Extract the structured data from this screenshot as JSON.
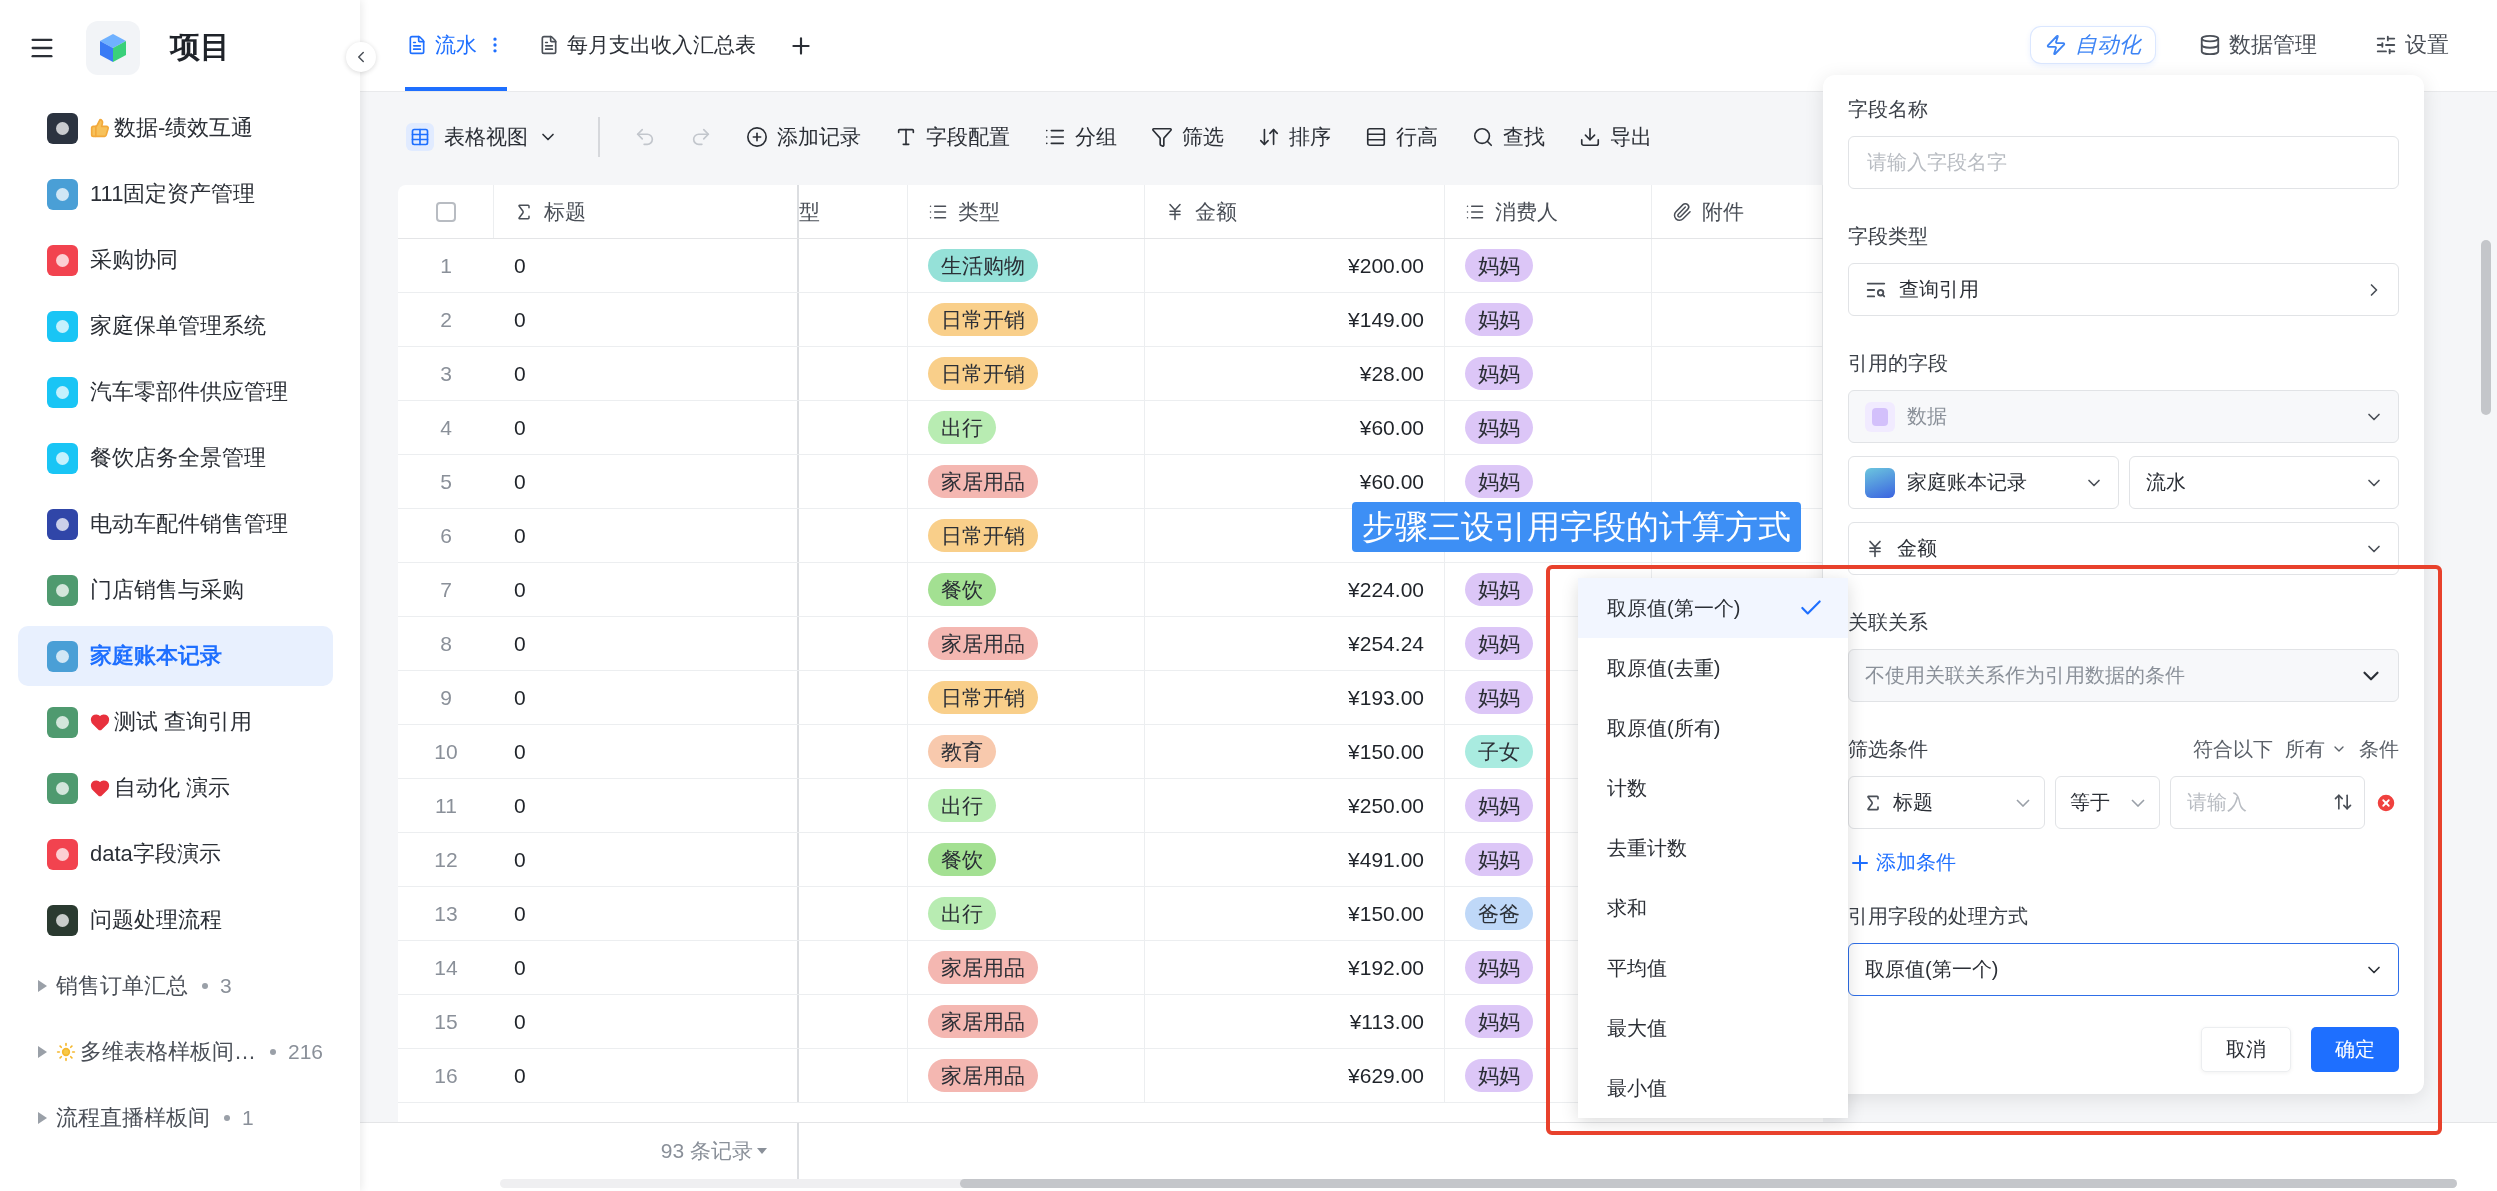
{
  "sidebar": {
    "title": "项目",
    "items": [
      {
        "label": "数据-绩效互通",
        "kind": "thumb",
        "color": "#2b3340",
        "selected": false
      },
      {
        "label": "111固定资产管理",
        "color": "#4a9fd6",
        "selected": false
      },
      {
        "label": "采购协同",
        "color": "#f2434f",
        "selected": false
      },
      {
        "label": "家庭保单管理系统",
        "color": "#19c5f5",
        "selected": false
      },
      {
        "label": "汽车零部件供应管理",
        "color": "#19c5f5",
        "selected": false
      },
      {
        "label": "餐饮店务全景管理",
        "color": "#19c5f5",
        "selected": false
      },
      {
        "label": "电动车配件销售管理",
        "color": "#3046a8",
        "selected": false
      },
      {
        "label": "门店销售与采购",
        "color": "#4f9a6f",
        "selected": false
      },
      {
        "label": "家庭账本记录",
        "color": "#4a9fd6",
        "selected": true
      },
      {
        "label": "测试 查询引用",
        "kind": "heart",
        "color": "#4f9a6f",
        "selected": false
      },
      {
        "label": "自动化 演示",
        "kind": "heart",
        "color": "#4f9a6f",
        "selected": false
      },
      {
        "label": "data字段演示",
        "color": "#f2434f",
        "selected": false
      },
      {
        "label": "问题处理流程",
        "color": "#2a3a30",
        "selected": false
      }
    ],
    "groups": [
      {
        "label": "销售订单汇总",
        "count": "3"
      },
      {
        "label": "多维表格样板间…",
        "kind": "sun",
        "count": "216"
      },
      {
        "label": "流程直播样板间",
        "count": "1"
      }
    ]
  },
  "tabs": [
    {
      "label": "流水",
      "selected": true
    },
    {
      "label": "每月支出收入汇总表",
      "selected": false
    }
  ],
  "top_actions": [
    {
      "kind": "automation",
      "label": "自动化",
      "selected": true
    },
    {
      "kind": "data",
      "label": "数据管理",
      "selected": false
    },
    {
      "kind": "settings",
      "label": "设置",
      "selected": false
    }
  ],
  "toolbar": {
    "view": "表格视图",
    "items": [
      {
        "kind": "undo",
        "disabled": true
      },
      {
        "kind": "redo",
        "disabled": true
      },
      {
        "kind": "add",
        "label": "添加记录",
        "disabled": false
      },
      {
        "kind": "fields",
        "label": "字段配置",
        "disabled": false
      },
      {
        "kind": "group",
        "label": "分组",
        "disabled": false
      },
      {
        "kind": "filter",
        "label": "筛选",
        "disabled": false
      },
      {
        "kind": "sort",
        "label": "排序",
        "disabled": false
      },
      {
        "kind": "height",
        "label": "行高",
        "disabled": false
      },
      {
        "kind": "find",
        "label": "查找",
        "disabled": false
      },
      {
        "kind": "export",
        "label": "导出",
        "disabled": false
      }
    ]
  },
  "table": {
    "select_all": {
      "checked": false
    },
    "columns": [
      {
        "kind": "sigma",
        "label": "标题"
      },
      {
        "kind": "none",
        "label": "型"
      },
      {
        "kind": "list",
        "label": "类型"
      },
      {
        "kind": "yen",
        "label": "金额"
      },
      {
        "kind": "list",
        "label": "消费人"
      },
      {
        "kind": "clip",
        "label": "附件"
      }
    ],
    "rows": [
      {
        "number": "1",
        "title": "0",
        "type": {
          "label": "生活购物",
          "color": "#95e1d8"
        },
        "amount": "¥200.00",
        "consumer": {
          "label": "妈妈",
          "color": "#dcc6f7"
        }
      },
      {
        "number": "2",
        "title": "0",
        "type": {
          "label": "日常开销",
          "color": "#f9cf8a"
        },
        "amount": "¥149.00",
        "consumer": {
          "label": "妈妈",
          "color": "#dcc6f7"
        }
      },
      {
        "number": "3",
        "title": "0",
        "type": {
          "label": "日常开销",
          "color": "#f9cf8a"
        },
        "amount": "¥28.00",
        "consumer": {
          "label": "妈妈",
          "color": "#dcc6f7"
        }
      },
      {
        "number": "4",
        "title": "0",
        "type": {
          "label": "出行",
          "color": "#b8ecb2"
        },
        "amount": "¥60.00",
        "consumer": {
          "label": "妈妈",
          "color": "#dcc6f7"
        }
      },
      {
        "number": "5",
        "title": "0",
        "type": {
          "label": "家居用品",
          "color": "#f4b7b1"
        },
        "amount": "¥60.00",
        "consumer": {
          "label": "妈妈",
          "color": "#dcc6f7"
        }
      },
      {
        "number": "6",
        "title": "0",
        "type": {
          "label": "日常开销",
          "color": "#f9cf8a"
        }
      },
      {
        "number": "7",
        "title": "0",
        "type": {
          "label": "餐饮",
          "color": "#a3e092"
        },
        "amount": "¥224.00",
        "consumer": {
          "label": "妈妈",
          "color": "#dcc6f7"
        }
      },
      {
        "number": "8",
        "title": "0",
        "type": {
          "label": "家居用品",
          "color": "#f4b7b1"
        },
        "amount": "¥254.24",
        "consumer": {
          "label": "妈妈",
          "color": "#dcc6f7"
        }
      },
      {
        "number": "9",
        "title": "0",
        "type": {
          "label": "日常开销",
          "color": "#f9cf8a"
        },
        "amount": "¥193.00",
        "consumer": {
          "label": "妈妈",
          "color": "#dcc6f7"
        }
      },
      {
        "number": "10",
        "title": "0",
        "type": {
          "label": "教育",
          "color": "#f8c9ad"
        },
        "amount": "¥150.00",
        "consumer": {
          "label": "子女",
          "color": "#a9ebe0"
        }
      },
      {
        "number": "11",
        "title": "0",
        "type": {
          "label": "出行",
          "color": "#b8ecb2"
        },
        "amount": "¥250.00",
        "consumer": {
          "label": "妈妈",
          "color": "#dcc6f7"
        }
      },
      {
        "number": "12",
        "title": "0",
        "type": {
          "label": "餐饮",
          "color": "#a3e092"
        },
        "amount": "¥491.00",
        "consumer": {
          "label": "妈妈",
          "color": "#dcc6f7"
        }
      },
      {
        "number": "13",
        "title": "0",
        "type": {
          "label": "出行",
          "color": "#b8ecb2"
        },
        "amount": "¥150.00",
        "consumer": {
          "label": "爸爸",
          "color": "#bfd8f8"
        }
      },
      {
        "number": "14",
        "title": "0",
        "type": {
          "label": "家居用品",
          "color": "#f4b7b1"
        },
        "amount": "¥192.00",
        "consumer": {
          "label": "妈妈",
          "color": "#dcc6f7"
        }
      },
      {
        "number": "15",
        "title": "0",
        "type": {
          "label": "家居用品",
          "color": "#f4b7b1"
        },
        "amount": "¥113.00",
        "consumer": {
          "label": "妈妈",
          "color": "#dcc6f7"
        }
      },
      {
        "number": "16",
        "title": "0",
        "type": {
          "label": "家居用品",
          "color": "#f4b7b1"
        },
        "amount": "¥629.00",
        "consumer": {
          "label": "妈妈",
          "color": "#dcc6f7"
        }
      }
    ],
    "footer": "93 条记录"
  },
  "field_panel": {
    "name_label": "字段名称",
    "name_placeholder": "请输入字段名字",
    "type_label": "字段类型",
    "type_value": "查询引用",
    "ref_label": "引用的字段",
    "ref_source": "数据",
    "ref_base": "家庭账本记录",
    "ref_table": "流水",
    "ref_field": "金额",
    "relation_label": "关联关系",
    "relation_value": "不使用关联关系作为引用数据的条件",
    "filter_label": "筛选条件",
    "match_prefix": "符合以下",
    "match_mode": "所有",
    "match_suffix": "条件",
    "conditions": [
      {
        "field": "标题",
        "operator": "等于",
        "placeholder": "请输入"
      }
    ],
    "add_condition": "添加条件",
    "method_label": "引用字段的处理方式",
    "method_value": "取原值(第一个)",
    "cancel": "取消",
    "confirm": "确定"
  },
  "method_menu": [
    {
      "label": "取原值(第一个)",
      "selected": true
    },
    {
      "label": "取原值(去重)",
      "selected": false
    },
    {
      "label": "取原值(所有)",
      "selected": false
    },
    {
      "label": "计数",
      "selected": false
    },
    {
      "label": "去重计数",
      "selected": false
    },
    {
      "label": "求和",
      "selected": false
    },
    {
      "label": "平均值",
      "selected": false
    },
    {
      "label": "最大值",
      "selected": false
    },
    {
      "label": "最小值",
      "selected": false
    }
  ],
  "annotation": "步骤三设引用字段的计算方式"
}
